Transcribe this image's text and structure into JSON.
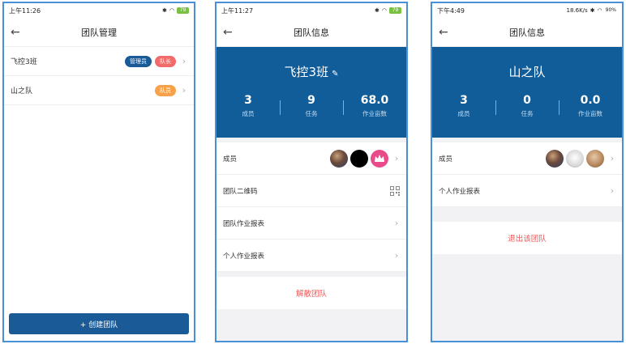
{
  "screen1": {
    "status_time": "上午11:26",
    "battery": "79",
    "title": "团队管理",
    "teams": [
      {
        "name": "飞控3班",
        "badges": [
          {
            "text": "管理员",
            "kind": "admin"
          },
          {
            "text": "队长",
            "kind": "leader"
          }
        ]
      },
      {
        "name": "山之队",
        "badges": [
          {
            "text": "队员",
            "kind": "member"
          }
        ]
      }
    ],
    "create_button": "+ 创建团队"
  },
  "screen2": {
    "status_time": "上午11:27",
    "battery": "79",
    "title": "团队信息",
    "team_name": "飞控3班",
    "stats": [
      {
        "value": "3",
        "label": "成员"
      },
      {
        "value": "9",
        "label": "任务"
      },
      {
        "value": "68.0",
        "label": "作业亩数"
      }
    ],
    "rows": {
      "members": "成员",
      "qrcode": "团队二维码",
      "team_report": "团队作业报表",
      "personal_report": "个人作业报表"
    },
    "dissolve": "解散团队"
  },
  "screen3": {
    "status_time": "下午4:49",
    "status_extra": "18.6K/s",
    "battery": "90%",
    "title": "团队信息",
    "team_name": "山之队",
    "stats": [
      {
        "value": "3",
        "label": "成员"
      },
      {
        "value": "0",
        "label": "任务"
      },
      {
        "value": "0.0",
        "label": "作业亩数"
      }
    ],
    "rows": {
      "members": "成员",
      "personal_report": "个人作业报表"
    },
    "leave": "退出该团队"
  },
  "colors": {
    "primary": "#115d9a",
    "button": "#1a5a96",
    "leader_badge": "#f26b6b",
    "member_badge": "#f7a24a",
    "danger_text": "#f25858",
    "phone_border": "#4a90d9"
  },
  "icons": [
    "back-arrow-icon",
    "pencil-icon",
    "chevron-right-icon",
    "qr-code-icon",
    "crown-icon",
    "bluetooth-icon",
    "wifi-icon",
    "battery-icon"
  ]
}
